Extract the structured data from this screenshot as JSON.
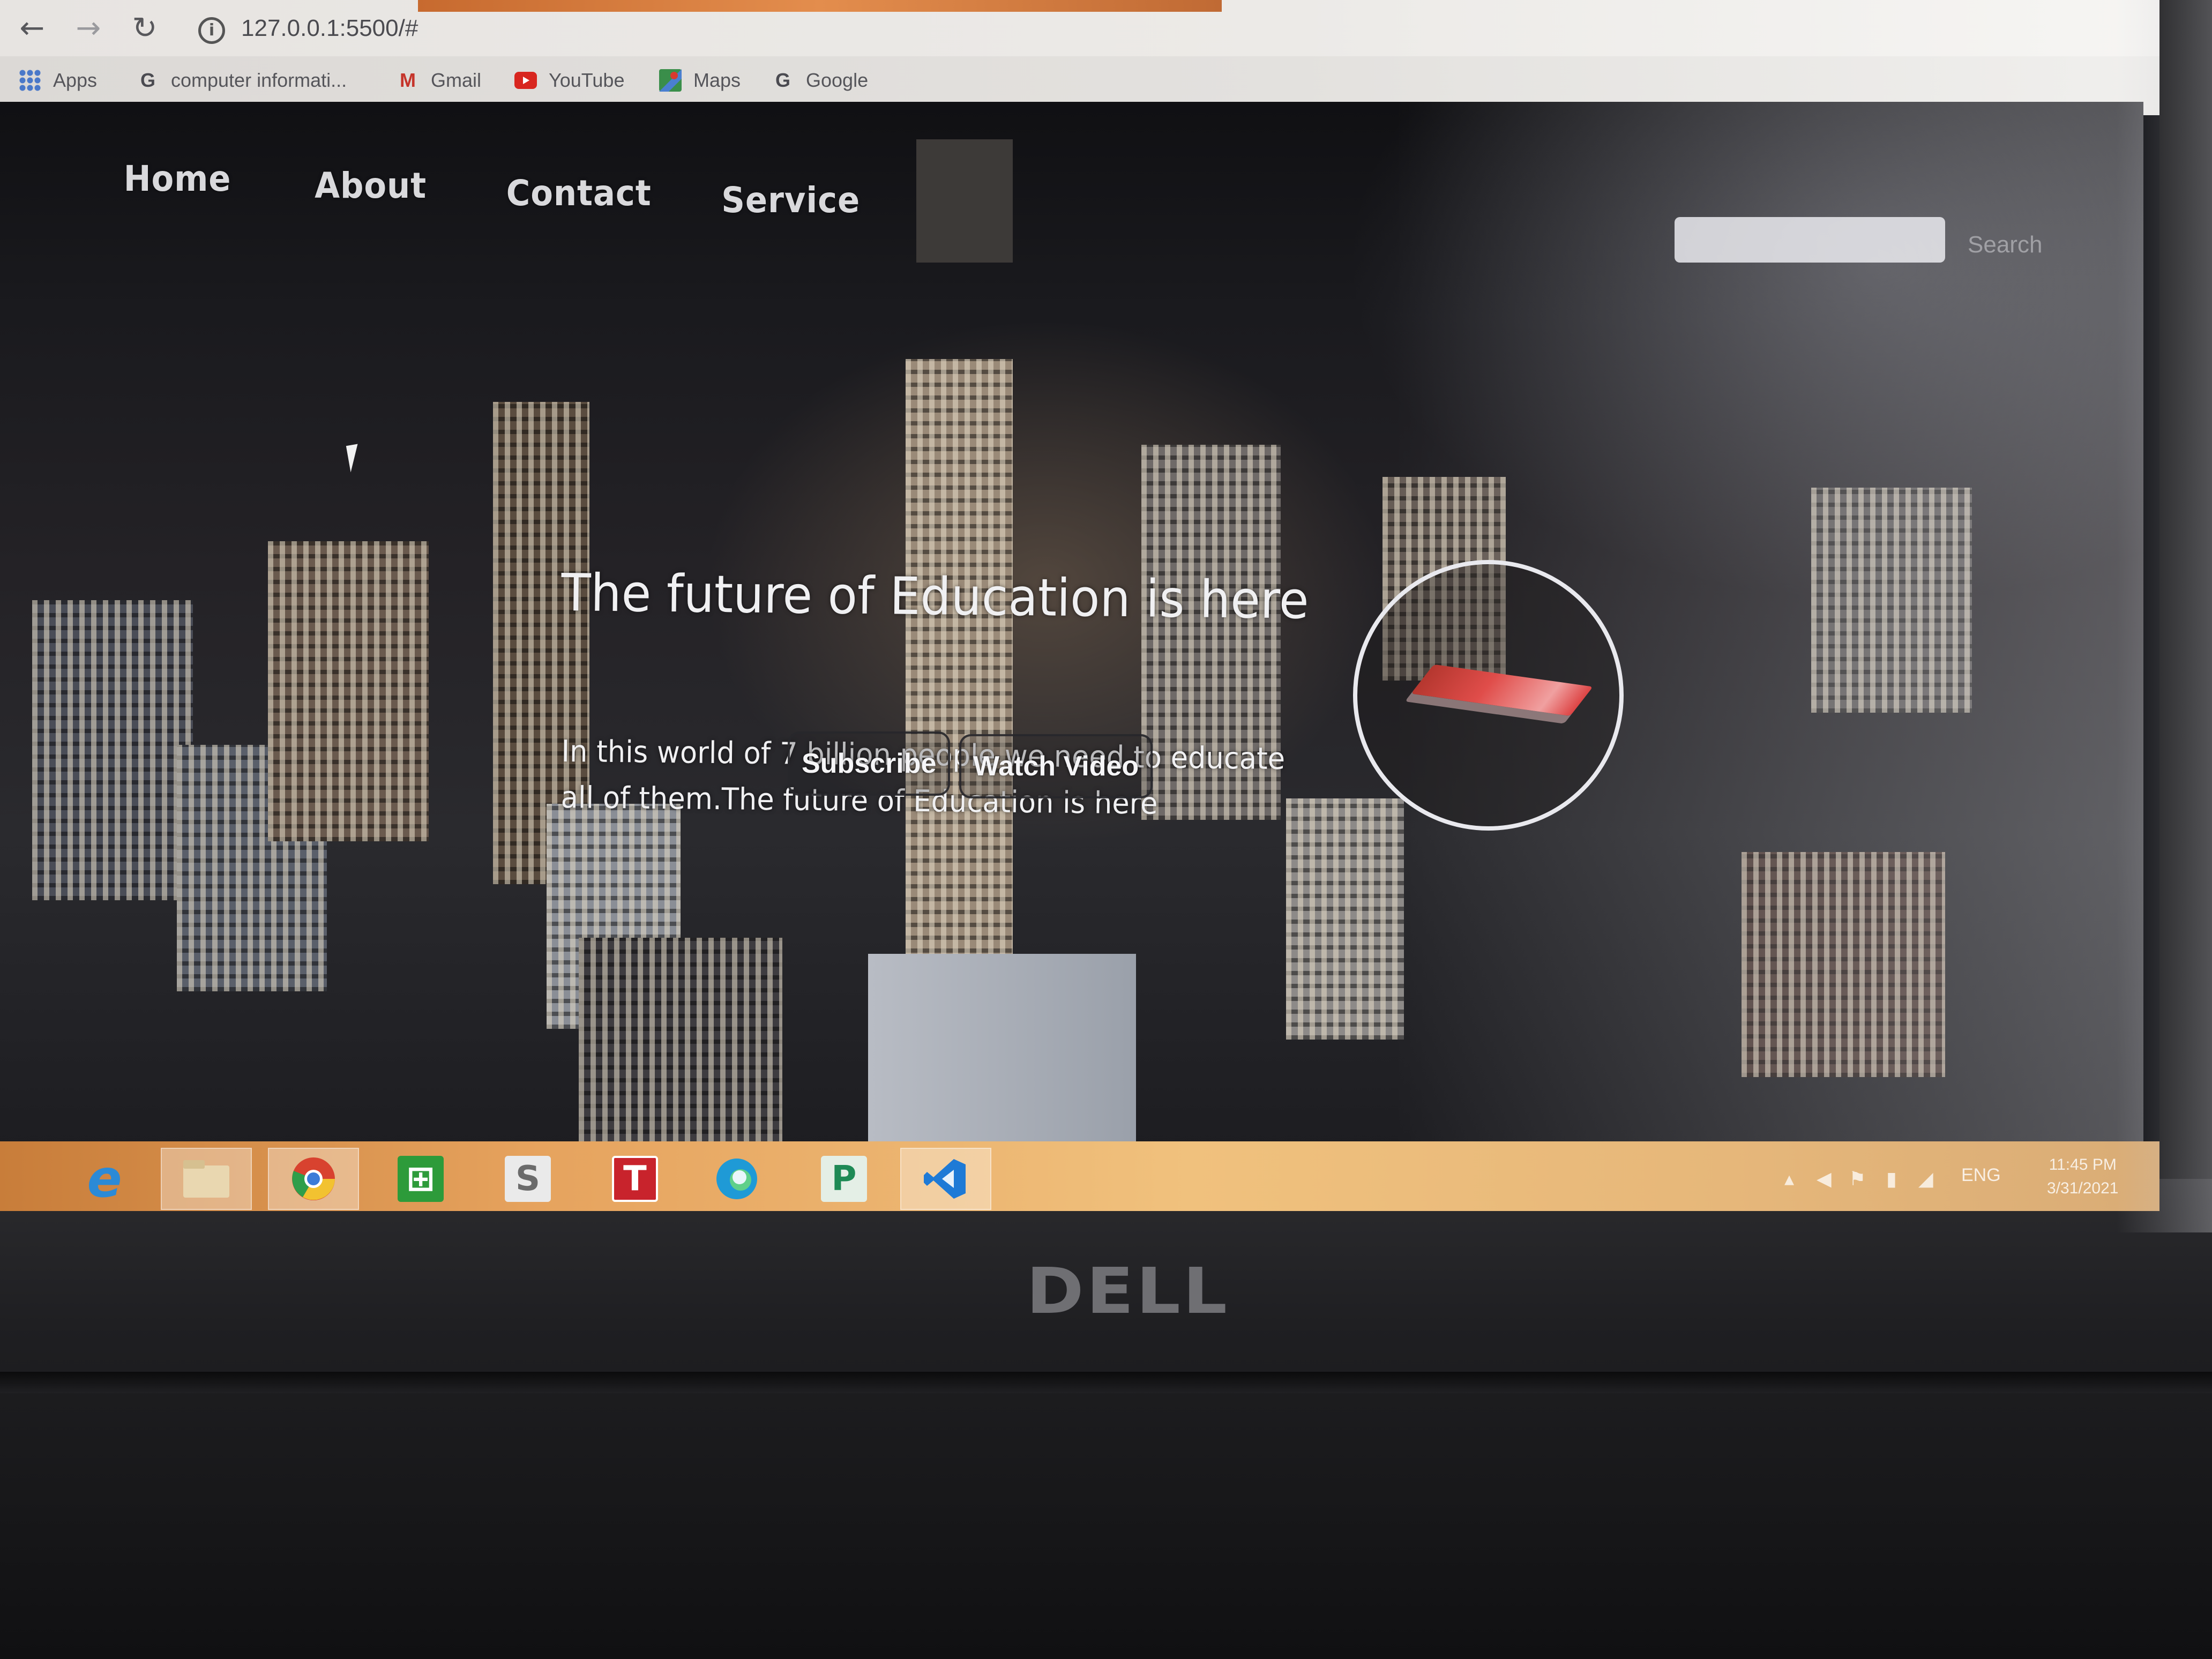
{
  "browser": {
    "url": "127.0.0.1:5500/#",
    "bookmarks": [
      {
        "label": "Apps",
        "icon": "apps-grid-icon"
      },
      {
        "label": "computer informati...",
        "icon": "google-icon"
      },
      {
        "label": "Gmail",
        "icon": "gmail-icon"
      },
      {
        "label": "YouTube",
        "icon": "youtube-icon"
      },
      {
        "label": "Maps",
        "icon": "maps-icon"
      },
      {
        "label": "Google",
        "icon": "google-icon"
      }
    ]
  },
  "site": {
    "nav": [
      "Home",
      "About",
      "Contact",
      "Service"
    ],
    "search_button": "Search",
    "search_placeholder": "",
    "hero_title": "The future of Education is here",
    "hero_subtitle": "In this world of 7 billion people we need to educate all of them.The future of Education is here",
    "subscribe_label": "Subscribe",
    "watch_video_label": "Watch Video"
  },
  "taskbar": {
    "apps": [
      {
        "name": "internet-explorer-icon",
        "glyph": "e",
        "color": "#2b8ad6"
      },
      {
        "name": "file-explorer-icon",
        "glyph": "",
        "color": "#e9d7b0"
      },
      {
        "name": "chrome-icon",
        "glyph": "",
        "color": "#d8422f"
      },
      {
        "name": "store-icon",
        "glyph": "⊞",
        "color": "#2d9b3a"
      },
      {
        "name": "sway-icon",
        "glyph": "S",
        "color": "#6b6b6b"
      },
      {
        "name": "typing-app-icon",
        "glyph": "T",
        "color": "#c8232c"
      },
      {
        "name": "edge-icon",
        "glyph": "",
        "color": "#1f9ad6"
      },
      {
        "name": "publisher-icon",
        "glyph": "P",
        "color": "#1e8a55"
      },
      {
        "name": "vscode-icon",
        "glyph": "",
        "color": "#1e7ad6"
      }
    ],
    "lang": "ENG",
    "time": "11:45 PM",
    "date": "3/31/2021"
  },
  "laptop": {
    "brand": "DELL"
  },
  "colors": {
    "taskbar_accent": "#e6a35e",
    "hero_text": "#f0f0f2",
    "nav_text": "#d9d9dc"
  }
}
